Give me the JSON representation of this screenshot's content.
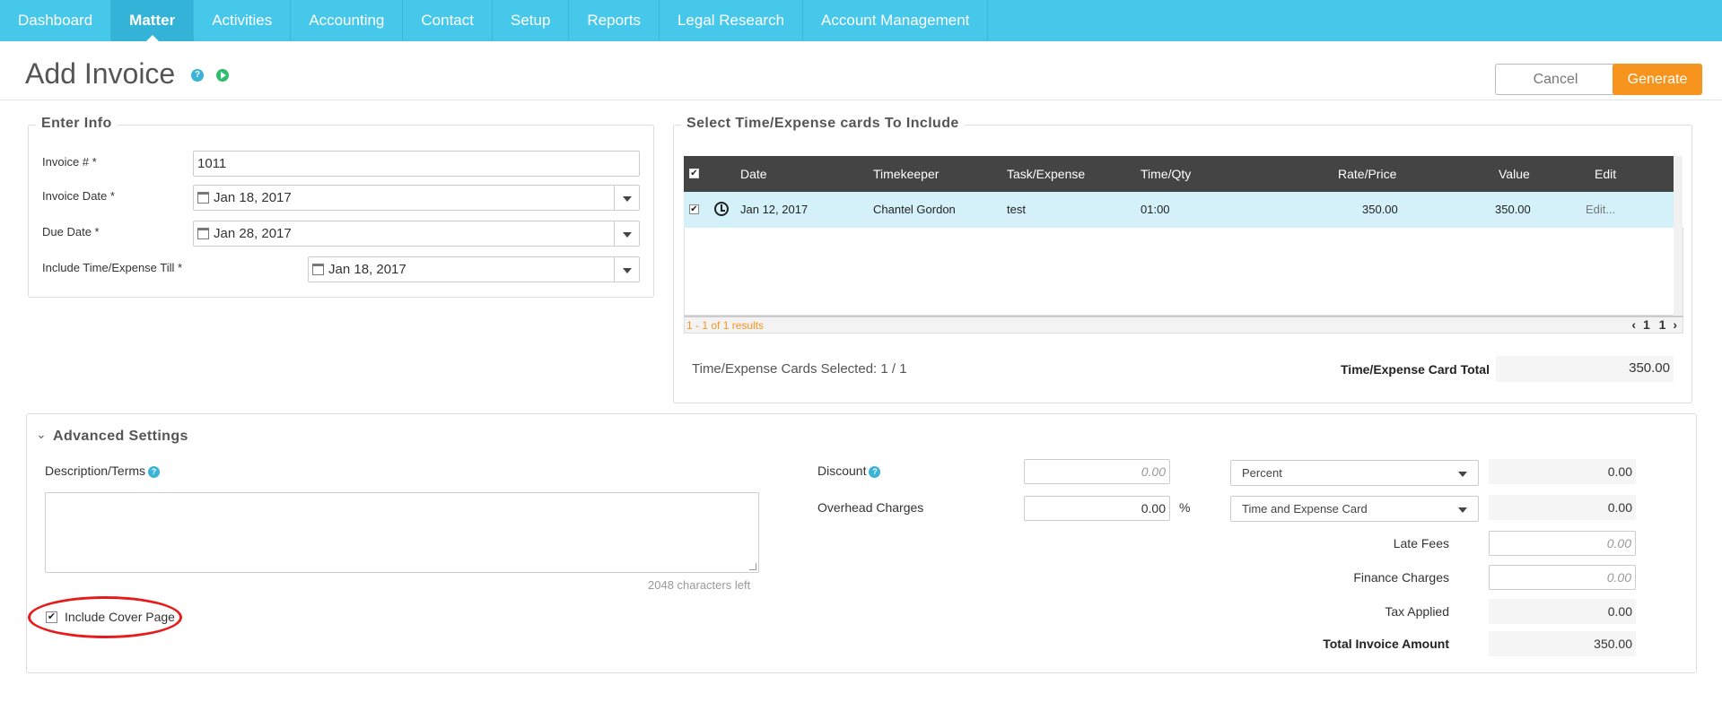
{
  "nav": {
    "items": [
      "Dashboard",
      "Matter",
      "Activities",
      "Accounting",
      "Contact",
      "Setup",
      "Reports",
      "Legal Research",
      "Account Management"
    ]
  },
  "header": {
    "title": "Add Invoice",
    "help_glyph": "?",
    "cancel_label": "Cancel",
    "generate_label": "Generate"
  },
  "enter_info": {
    "legend": "Enter Info",
    "invoice_no_label": "Invoice # *",
    "invoice_no_value": "1011",
    "invoice_date_label": "Invoice Date *",
    "invoice_date_value": "Jan 18, 2017",
    "due_date_label": "Due Date *",
    "due_date_value": "Jan 28, 2017",
    "include_till_label": "Include Time/Expense Till *",
    "include_till_value": "Jan 18, 2017"
  },
  "cards": {
    "legend": "Select Time/Expense cards To Include",
    "columns": [
      "Date",
      "Timekeeper",
      "Task/Expense",
      "Time/Qty",
      "Rate/Price",
      "Value",
      "Edit"
    ],
    "rows": [
      {
        "checked": "✔",
        "date": "Jan 12, 2017",
        "timekeeper": "Chantel Gordon",
        "task": "test",
        "qty": "01:00",
        "rate": "350.00",
        "value": "350.00",
        "edit": "Edit..."
      }
    ],
    "header_check": "✔",
    "results_text": "1 - 1 of 1 results",
    "pager_prev": "‹",
    "pager_page": "1",
    "pager_total": "1",
    "pager_next": "›",
    "selected_text": "Time/Expense Cards Selected: 1 / 1",
    "total_label": "Time/Expense Card Total",
    "total_value": "350.00"
  },
  "advanced": {
    "legend": "Advanced Settings",
    "chevron": "⌄",
    "description_label": "Description/Terms",
    "chars_left": "2048 characters left",
    "cover_check": "✔",
    "cover_label": "Include Cover Page",
    "discount_label": "Discount",
    "discount_placeholder": "0.00",
    "discount_type": "Percent",
    "discount_amount": "0.00",
    "overhead_label": "Overhead Charges",
    "overhead_value": "0.00",
    "overhead_unit": "%",
    "overhead_type": "Time and Expense Card",
    "overhead_amount": "0.00",
    "late_fees_label": "Late Fees",
    "late_fees_placeholder": "0.00",
    "finance_label": "Finance Charges",
    "finance_placeholder": "0.00",
    "tax_label": "Tax Applied",
    "tax_value": "0.00",
    "total_label": "Total Invoice Amount",
    "total_value": "350.00"
  },
  "colors": {
    "nav_bg": "#46c8ea",
    "generate_bg": "#f7941d",
    "row_highlight": "#d4f1fa",
    "annotation": "#e61c1c"
  }
}
